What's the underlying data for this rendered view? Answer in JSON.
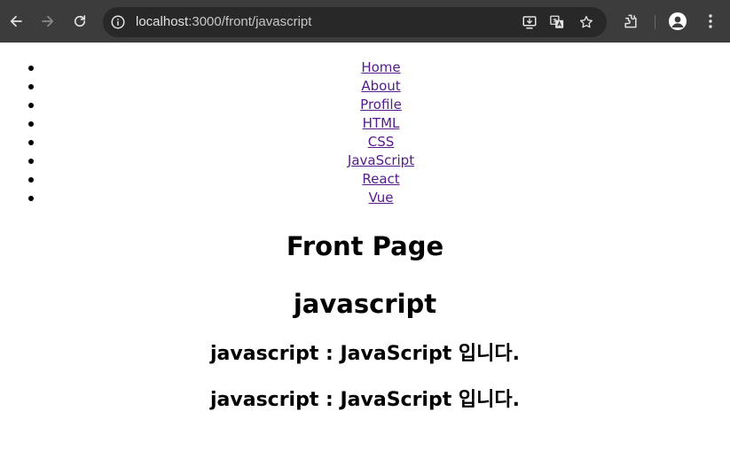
{
  "browser": {
    "url_host": "localhost",
    "url_rest": ":3000/front/javascript",
    "icons": [
      "back-icon",
      "forward-icon",
      "reload-icon",
      "info-icon",
      "install-icon",
      "translate-icon",
      "star-icon",
      "extensions-icon",
      "profile-icon",
      "menu-icon"
    ],
    "colors": {
      "chrome_bg": "#3c3c3c",
      "omnibox_bg": "#282828"
    }
  },
  "nav": {
    "items": [
      {
        "label": "Home"
      },
      {
        "label": "About"
      },
      {
        "label": "Profile"
      },
      {
        "label": "HTML"
      },
      {
        "label": "CSS"
      },
      {
        "label": "JavaScript"
      },
      {
        "label": "React"
      },
      {
        "label": "Vue"
      }
    ],
    "link_color": "#551a8b"
  },
  "content": {
    "page_title": "Front Page",
    "topic_heading": "javascript",
    "lines": [
      "javascript : JavaScript 입니다.",
      "javascript : JavaScript 입니다."
    ]
  }
}
